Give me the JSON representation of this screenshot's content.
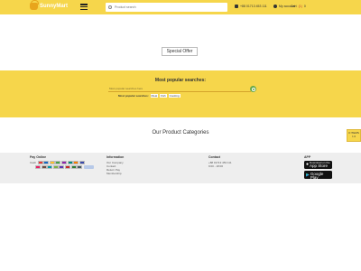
{
  "header": {
    "logo_text": "SunnyMart",
    "search_placeholder": "Product search",
    "phone": "+88 01713 453 111",
    "account_label": "My account",
    "cart_label": "Cart",
    "cart_count": "(1)",
    "cart_total": "0"
  },
  "special_offer": {
    "label": "Special Offer"
  },
  "popular": {
    "title": "Most popular searches:",
    "input_placeholder": "Most popular searches here",
    "list_label": "Most popular searches:",
    "tags": [
      "Meat",
      "Fish",
      "Cooking"
    ]
  },
  "categories": {
    "title": "Our Product Categories"
  },
  "side_tab": {
    "line1": "0 ITEMS",
    "line2": "৳ 0"
  },
  "footer": {
    "pay": {
      "title": "Pay Online",
      "cash_label": "Cash",
      "badge_colors": [
        "#e53935",
        "#1565c0",
        "#fbc02d",
        "#43a047",
        "#8e24aa",
        "#00897b",
        "#f57c00",
        "#3949ab",
        "#e91e63",
        "#6d4c41",
        "#0097a7",
        "#7cb342",
        "#5e35b1",
        "#c62828",
        "#2e7d32",
        "#455a64"
      ]
    },
    "information": {
      "title": "Information",
      "links": [
        "Our Company",
        "Contact",
        "Return Pay",
        "Membership"
      ]
    },
    "contact": {
      "title": "Contact",
      "phone": "+88 01713 453 111",
      "hours": "9:00 - 18:00"
    },
    "app": {
      "title": "APP",
      "apple_small": "Download on the",
      "apple_big": "App Store",
      "google_small": "GET IT ON",
      "google_big": "Google Play"
    }
  }
}
